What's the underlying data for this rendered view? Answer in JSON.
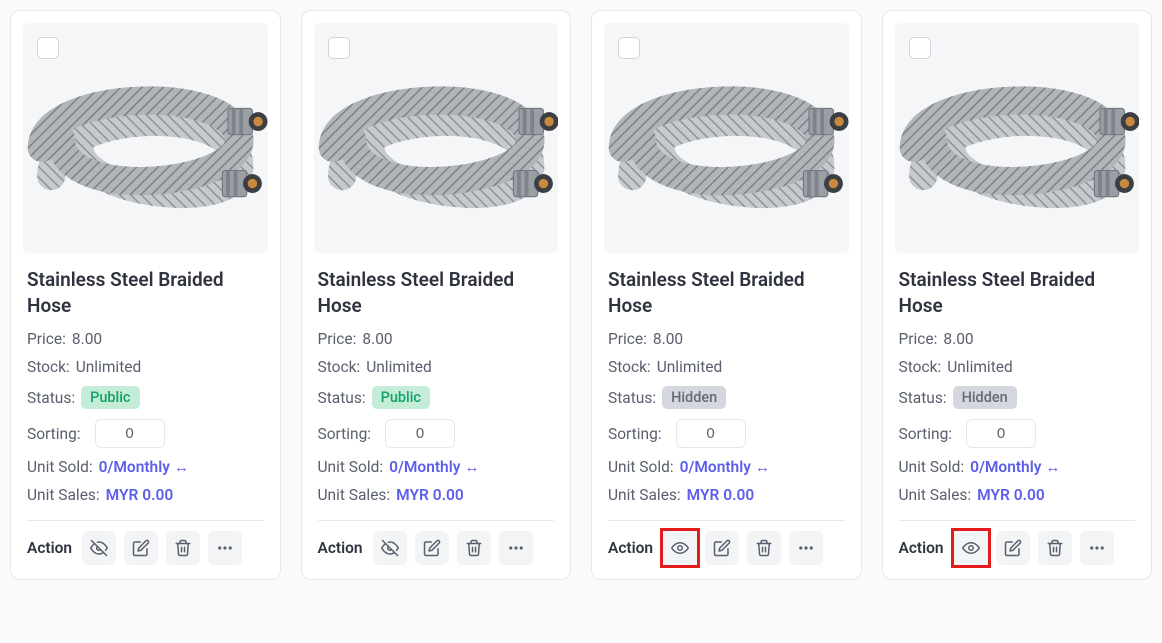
{
  "labels": {
    "price": "Price:",
    "stock": "Stock:",
    "status": "Status:",
    "sorting": "Sorting:",
    "unit_sold": "Unit Sold:",
    "unit_sales": "Unit Sales:",
    "action": "Action"
  },
  "products": [
    {
      "title": "Stainless Steel Braided Hose",
      "price": "8.00",
      "stock": "Unlimited",
      "status": "Public",
      "status_class": "public",
      "sorting": "0",
      "unit_sold": "0/Monthly",
      "unit_sales": "MYR 0.00",
      "visibility_icon": "eye-off",
      "visibility_highlighted": false
    },
    {
      "title": "Stainless Steel Braided Hose",
      "price": "8.00",
      "stock": "Unlimited",
      "status": "Public",
      "status_class": "public",
      "sorting": "0",
      "unit_sold": "0/Monthly",
      "unit_sales": "MYR 0.00",
      "visibility_icon": "eye-off",
      "visibility_highlighted": false
    },
    {
      "title": "Stainless Steel Braided Hose",
      "price": "8.00",
      "stock": "Unlimited",
      "status": "Hidden",
      "status_class": "hidden",
      "sorting": "0",
      "unit_sold": "0/Monthly",
      "unit_sales": "MYR 0.00",
      "visibility_icon": "eye",
      "visibility_highlighted": true
    },
    {
      "title": "Stainless Steel Braided Hose",
      "price": "8.00",
      "stock": "Unlimited",
      "status": "Hidden",
      "status_class": "hidden",
      "sorting": "0",
      "unit_sold": "0/Monthly",
      "unit_sales": "MYR 0.00",
      "visibility_icon": "eye",
      "visibility_highlighted": true
    }
  ]
}
